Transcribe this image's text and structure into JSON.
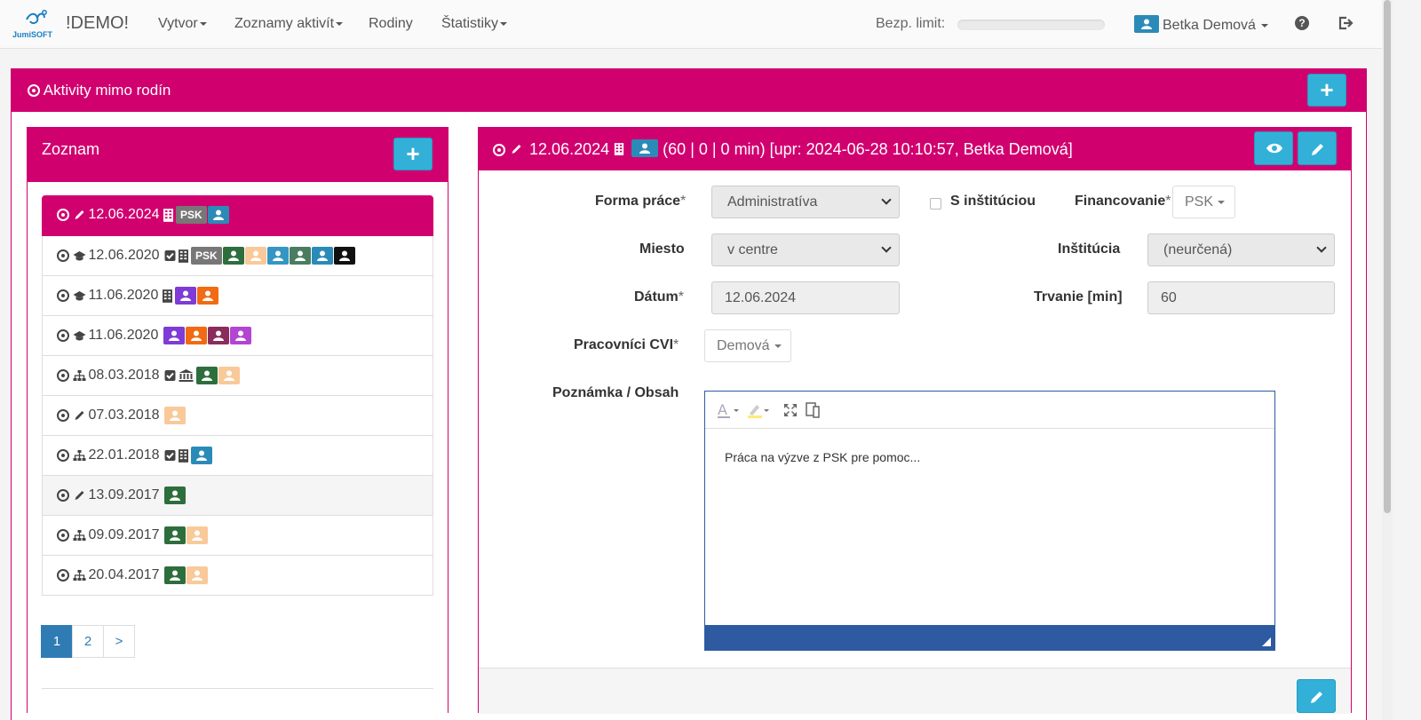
{
  "nav": {
    "logo_text": "JumiSOFT",
    "brand": "!DEMO!",
    "items": [
      {
        "label": "Vytvor",
        "caret": true
      },
      {
        "label": "Zoznamy aktivít",
        "caret": true
      },
      {
        "label": "Rodiny",
        "caret": false
      },
      {
        "label": "Štatistiky",
        "caret": true
      }
    ],
    "limit_label": "Bezp. limit:",
    "user_name": "Betka Demová",
    "help_icon": "?"
  },
  "main": {
    "title": "Aktivity mimo rodín",
    "add_label": "+"
  },
  "list_panel": {
    "title": "Zoznam",
    "add_label": "+",
    "rows": [
      {
        "date": "12.06.2024",
        "type_icon": "pencil-icon",
        "active": true
      },
      {
        "date": "12.06.2020",
        "type_icon": "graduation-cap-icon"
      },
      {
        "date": "11.06.2020",
        "type_icon": "graduation-cap-icon"
      },
      {
        "date": "11.06.2020",
        "type_icon": "graduation-cap-icon"
      },
      {
        "date": "08.03.2018",
        "type_icon": "sitemap-icon"
      },
      {
        "date": "07.03.2018",
        "type_icon": "pencil-icon"
      },
      {
        "date": "22.01.2018",
        "type_icon": "sitemap-icon"
      },
      {
        "date": "13.09.2017",
        "type_icon": "pencil-icon",
        "hover": true
      },
      {
        "date": "09.09.2017",
        "type_icon": "sitemap-icon"
      },
      {
        "date": "20.04.2017",
        "type_icon": "sitemap-icon"
      }
    ],
    "psk_label": "PSK",
    "pager": [
      "1",
      "2",
      ">"
    ]
  },
  "detail": {
    "header": "12.06.2024",
    "header_rest": "(60 | 0 | 0 min) [upr: 2024-06-28 10:10:57, Betka Demová]",
    "forma_label": "Forma práce",
    "forma_value": "Administratíva",
    "s_institucia_label": "S inštitúciou",
    "financovanie_label": "Financovanie",
    "financovanie_value": "PSK",
    "miesto_label": "Miesto",
    "miesto_value": "v centre",
    "institucia_label": "Inštitúcia",
    "institucia_value": "(neurčená)",
    "datum_label": "Dátum",
    "datum_value": "12.06.2024",
    "trvanie_label": "Trvanie [min]",
    "trvanie_value": "60",
    "pracovnici_label": "Pracovníci CVI",
    "pracovnici_value": "Demová",
    "poznamka_label": "Poznámka / Obsah",
    "poznamka_value": "Práca na výzve z PSK pre pomoc...",
    "required_mark": "*"
  },
  "colors": {
    "primary": "#d1006f",
    "info": "#33b0d8",
    "link": "#2f7bb4",
    "editor": "#2d5aa1"
  }
}
